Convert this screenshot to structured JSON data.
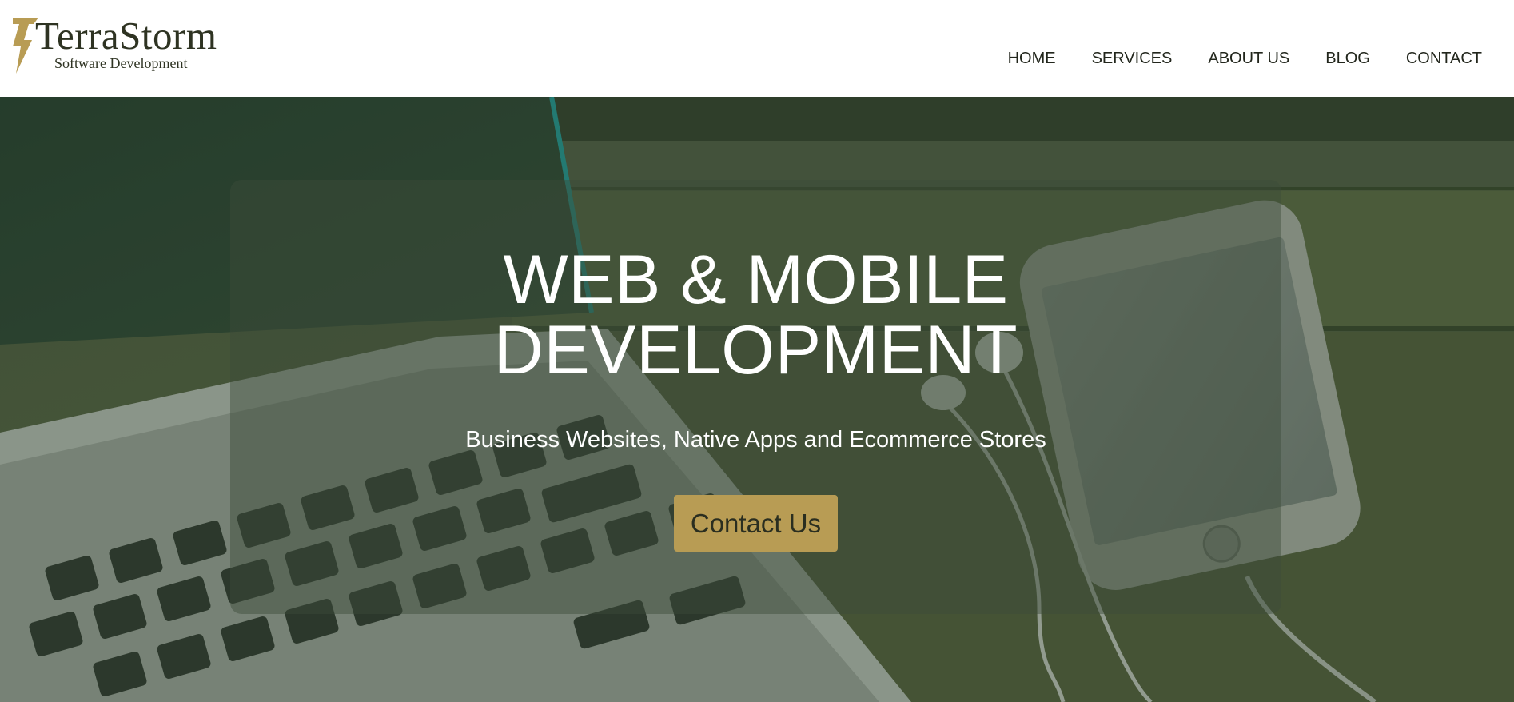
{
  "header": {
    "logo_title": "TerraStorm",
    "logo_subtitle": "Software Development",
    "nav": [
      "HOME",
      "SERVICES",
      "ABOUT US",
      "BLOG",
      "CONTACT"
    ]
  },
  "hero": {
    "title_line1": "WEB & MOBILE",
    "title_line2": "DEVELOPMENT",
    "subtitle": "Business Websites, Native Apps and Ecommerce Stores",
    "cta_label": "Contact Us"
  },
  "colors": {
    "brand_gold": "#b89c54",
    "brand_dark": "#2e3322",
    "hero_tint": "#3c4a32"
  },
  "icons": [
    "lightning-bolt-icon"
  ]
}
